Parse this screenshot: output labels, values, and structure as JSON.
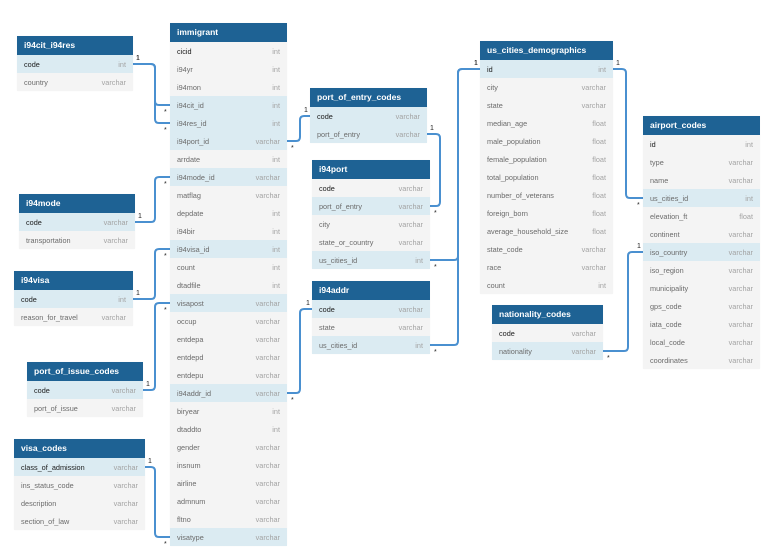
{
  "diagram": {
    "type": "entity-relationship",
    "colors": {
      "header": "#1e6294",
      "link": "#4a90d0",
      "key_row": "#dbebf2",
      "row": "#f4f4f4"
    },
    "tables": [
      {
        "id": "immigrant",
        "name": "immigrant",
        "columns": [
          {
            "name": "cicid",
            "type": "int",
            "pk": true
          },
          {
            "name": "i94yr",
            "type": "int"
          },
          {
            "name": "i94mon",
            "type": "int"
          },
          {
            "name": "i94cit_id",
            "type": "int",
            "fk": true
          },
          {
            "name": "i94res_id",
            "type": "int",
            "fk": true
          },
          {
            "name": "i94port_id",
            "type": "varchar",
            "fk": true
          },
          {
            "name": "arrdate",
            "type": "int"
          },
          {
            "name": "i94mode_id",
            "type": "varchar",
            "fk": true
          },
          {
            "name": "matflag",
            "type": "varchar"
          },
          {
            "name": "depdate",
            "type": "int"
          },
          {
            "name": "i94bir",
            "type": "int"
          },
          {
            "name": "i94visa_id",
            "type": "int",
            "fk": true
          },
          {
            "name": "count",
            "type": "int"
          },
          {
            "name": "dtadfile",
            "type": "int"
          },
          {
            "name": "visapost",
            "type": "varchar",
            "fk": true
          },
          {
            "name": "occup",
            "type": "varchar"
          },
          {
            "name": "entdepa",
            "type": "varchar"
          },
          {
            "name": "entdepd",
            "type": "varchar"
          },
          {
            "name": "entdepu",
            "type": "varchar"
          },
          {
            "name": "i94addr_id",
            "type": "varchar",
            "fk": true
          },
          {
            "name": "biryear",
            "type": "int"
          },
          {
            "name": "dtaddto",
            "type": "int"
          },
          {
            "name": "gender",
            "type": "varchar"
          },
          {
            "name": "insnum",
            "type": "varchar"
          },
          {
            "name": "airline",
            "type": "varchar"
          },
          {
            "name": "admnum",
            "type": "varchar"
          },
          {
            "name": "fltno",
            "type": "varchar"
          },
          {
            "name": "visatype",
            "type": "varchar",
            "fk": true
          }
        ]
      },
      {
        "id": "i94cit_i94res",
        "name": "i94cit_i94res",
        "columns": [
          {
            "name": "code",
            "type": "int",
            "pk": true,
            "key": true
          },
          {
            "name": "country",
            "type": "varchar"
          }
        ]
      },
      {
        "id": "i94mode",
        "name": "i94mode",
        "columns": [
          {
            "name": "code",
            "type": "varchar",
            "pk": true,
            "key": true
          },
          {
            "name": "transportation",
            "type": "varchar"
          }
        ]
      },
      {
        "id": "i94visa",
        "name": "i94visa",
        "columns": [
          {
            "name": "code",
            "type": "int",
            "pk": true,
            "key": true
          },
          {
            "name": "reason_for_travel",
            "type": "varchar"
          }
        ]
      },
      {
        "id": "port_of_issue_codes",
        "name": "port_of_issue_codes",
        "columns": [
          {
            "name": "code",
            "type": "varchar",
            "pk": true,
            "key": true
          },
          {
            "name": "port_of_issue",
            "type": "varchar"
          }
        ]
      },
      {
        "id": "visa_codes",
        "name": "visa_codes",
        "columns": [
          {
            "name": "class_of_admission",
            "type": "varchar",
            "pk": true,
            "key": true
          },
          {
            "name": "ins_status_code",
            "type": "varchar"
          },
          {
            "name": "description",
            "type": "varchar"
          },
          {
            "name": "section_of_law",
            "type": "varchar"
          }
        ]
      },
      {
        "id": "port_of_entry_codes",
        "name": "port_of_entry_codes",
        "columns": [
          {
            "name": "code",
            "type": "varchar",
            "pk": true,
            "key": true
          },
          {
            "name": "port_of_entry",
            "type": "varchar",
            "key": true
          }
        ]
      },
      {
        "id": "i94port",
        "name": "i94port",
        "columns": [
          {
            "name": "code",
            "type": "varchar",
            "pk": true
          },
          {
            "name": "port_of_entry",
            "type": "varchar",
            "fk": true
          },
          {
            "name": "city",
            "type": "varchar"
          },
          {
            "name": "state_or_country",
            "type": "varchar"
          },
          {
            "name": "us_cities_id",
            "type": "int",
            "fk": true
          }
        ]
      },
      {
        "id": "i94addr",
        "name": "i94addr",
        "columns": [
          {
            "name": "code",
            "type": "varchar",
            "pk": true,
            "key": true
          },
          {
            "name": "state",
            "type": "varchar"
          },
          {
            "name": "us_cities_id",
            "type": "int",
            "fk": true
          }
        ]
      },
      {
        "id": "us_cities_demographics",
        "name": "us_cities_demographics",
        "columns": [
          {
            "name": "id",
            "type": "int",
            "pk": true,
            "key": true
          },
          {
            "name": "city",
            "type": "varchar"
          },
          {
            "name": "state",
            "type": "varchar"
          },
          {
            "name": "median_age",
            "type": "float"
          },
          {
            "name": "male_population",
            "type": "float"
          },
          {
            "name": "female_population",
            "type": "float"
          },
          {
            "name": "total_population",
            "type": "float"
          },
          {
            "name": "number_of_veterans",
            "type": "float"
          },
          {
            "name": "foreign_born",
            "type": "float"
          },
          {
            "name": "average_household_size",
            "type": "float"
          },
          {
            "name": "state_code",
            "type": "varchar"
          },
          {
            "name": "race",
            "type": "varchar"
          },
          {
            "name": "count",
            "type": "int"
          }
        ]
      },
      {
        "id": "nationality_codes",
        "name": "nationality_codes",
        "columns": [
          {
            "name": "code",
            "type": "varchar",
            "pk": true
          },
          {
            "name": "nationality",
            "type": "varchar",
            "fk": true
          }
        ]
      },
      {
        "id": "airport_codes",
        "name": "airport_codes",
        "columns": [
          {
            "name": "id",
            "type": "int",
            "pk": true
          },
          {
            "name": "type",
            "type": "varchar"
          },
          {
            "name": "name",
            "type": "varchar"
          },
          {
            "name": "us_cities_id",
            "type": "int",
            "fk": true
          },
          {
            "name": "elevation_ft",
            "type": "float"
          },
          {
            "name": "continent",
            "type": "varchar"
          },
          {
            "name": "iso_country",
            "type": "varchar",
            "key": true
          },
          {
            "name": "iso_region",
            "type": "varchar"
          },
          {
            "name": "municipality",
            "type": "varchar"
          },
          {
            "name": "gps_code",
            "type": "varchar"
          },
          {
            "name": "iata_code",
            "type": "varchar"
          },
          {
            "name": "local_code",
            "type": "varchar"
          },
          {
            "name": "coordinates",
            "type": "varchar"
          }
        ]
      }
    ],
    "relationships": [
      {
        "one": "i94cit_i94res.code",
        "many": "immigrant.i94cit_id",
        "one_label": "1",
        "many_label": "*"
      },
      {
        "one": "i94cit_i94res.code",
        "many": "immigrant.i94res_id",
        "one_label": "1",
        "many_label": "*"
      },
      {
        "one": "port_of_entry_codes.code",
        "many": "immigrant.i94port_id",
        "one_label": "1",
        "many_label": "*"
      },
      {
        "one": "i94mode.code",
        "many": "immigrant.i94mode_id",
        "one_label": "1",
        "many_label": "*"
      },
      {
        "one": "i94visa.code",
        "many": "immigrant.i94visa_id",
        "one_label": "1",
        "many_label": "*"
      },
      {
        "one": "port_of_issue_codes.code",
        "many": "immigrant.visapost",
        "one_label": "1",
        "many_label": "*"
      },
      {
        "one": "i94addr.code",
        "many": "immigrant.i94addr_id",
        "one_label": "1",
        "many_label": "*"
      },
      {
        "one": "visa_codes.class_of_admission",
        "many": "immigrant.visatype",
        "one_label": "1",
        "many_label": "*"
      },
      {
        "one": "port_of_entry_codes.port_of_entry",
        "many": "i94port.port_of_entry",
        "one_label": "1",
        "many_label": "*"
      },
      {
        "one": "us_cities_demographics.id",
        "many": "i94port.us_cities_id",
        "one_label": "1",
        "many_label": "*"
      },
      {
        "one": "us_cities_demographics.id",
        "many": "i94addr.us_cities_id",
        "one_label": "1",
        "many_label": "*"
      },
      {
        "one": "us_cities_demographics.id",
        "many": "airport_codes.us_cities_id",
        "one_label": "1",
        "many_label": "*"
      },
      {
        "one": "airport_codes.iso_country",
        "many": "nationality_codes.nationality",
        "one_label": "1",
        "many_label": "*"
      }
    ]
  }
}
